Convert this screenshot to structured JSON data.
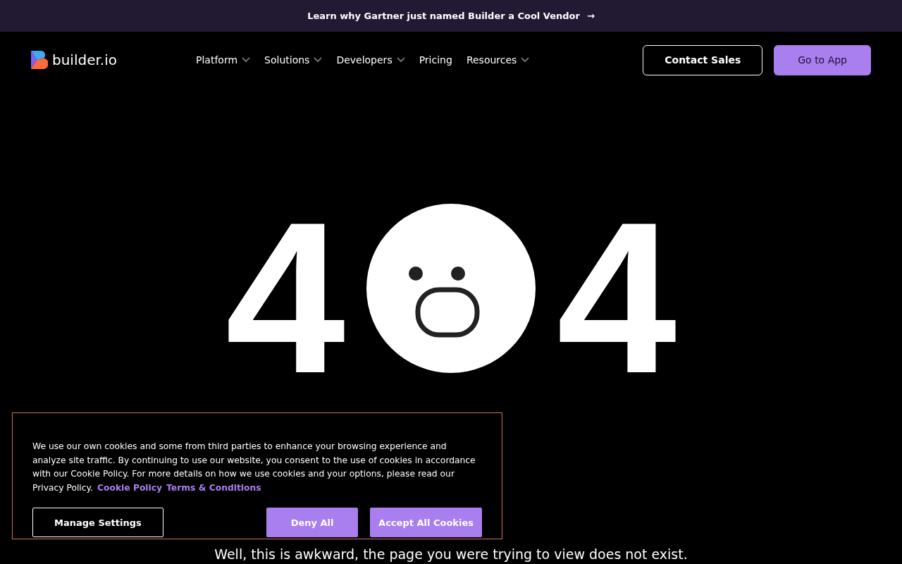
{
  "announcement": {
    "text": "Learn why Gartner just named Builder a Cool Vendor",
    "arrow": "→"
  },
  "nav": {
    "logo": "builder.io",
    "links": [
      {
        "label": "Platform",
        "dropdown": true
      },
      {
        "label": "Solutions",
        "dropdown": true
      },
      {
        "label": "Developers",
        "dropdown": true
      },
      {
        "label": "Pricing",
        "dropdown": false
      },
      {
        "label": "Resources",
        "dropdown": true
      }
    ],
    "buttons": [
      {
        "label": "Contact Sales",
        "kind": "outline"
      },
      {
        "label": "Go to App",
        "kind": "filled"
      }
    ]
  },
  "error": {
    "digits": [
      "4",
      "4"
    ],
    "message": "Well, this is awkward, the page you were trying to view does not exist."
  },
  "cookie_banner": {
    "text": "We use our own cookies and some from third parties to enhance your browsing experience and analyze site traffic. By continuing to use our website, you consent to the use of cookies in accordance with our Cookie Policy. For more details on how we use cookies and your options, please read our Privacy Policy.",
    "links": [
      "Cookie Policy",
      "Terms & Conditions"
    ],
    "buttons": [
      {
        "label": "Manage Settings",
        "kind": "outline"
      },
      {
        "label": "Deny All",
        "kind": "filled"
      },
      {
        "label": "Accept All Cookies",
        "kind": "filled"
      }
    ]
  }
}
